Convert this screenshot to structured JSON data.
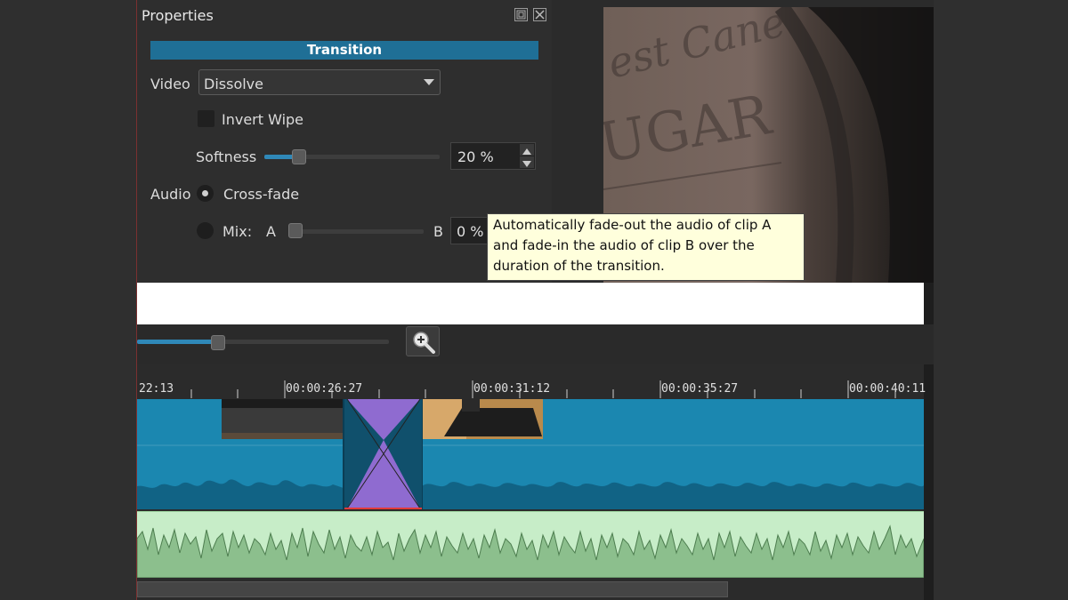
{
  "properties": {
    "title": "Properties",
    "section_title": "Transition",
    "video_label": "Video",
    "video_value": "Dissolve",
    "invert_wipe_label": "Invert Wipe",
    "softness_label": "Softness",
    "softness_value": "20 %",
    "softness_level": 0.2,
    "audio_label": "Audio",
    "crossfade_label": "Cross-fade",
    "mix_label": "Mix:",
    "mix_a": "A",
    "mix_b": "B",
    "mix_value": "0 %",
    "mix_level": 0.0
  },
  "tooltip": {
    "line1": "Automatically fade-out the audio of clip A",
    "line2": "and fade-in the audio of clip B over the",
    "line3": "duration of the transition."
  },
  "timeline": {
    "ticks": [
      "22:13",
      "00:00:26:27",
      "00:00:31:12",
      "00:00:35:27",
      "00:00:40:11"
    ],
    "zoom_level": 0.32
  },
  "colors": {
    "accent": "#1f6f96",
    "video_track": "#1b87b0",
    "transition": "#9b6fd6",
    "audio_track": "#c7edc8",
    "tooltip_bg": "#ffffdc"
  },
  "icons": [
    "dock-float-icon",
    "close-icon",
    "chevron-down-icon",
    "zoom-in-icon"
  ]
}
